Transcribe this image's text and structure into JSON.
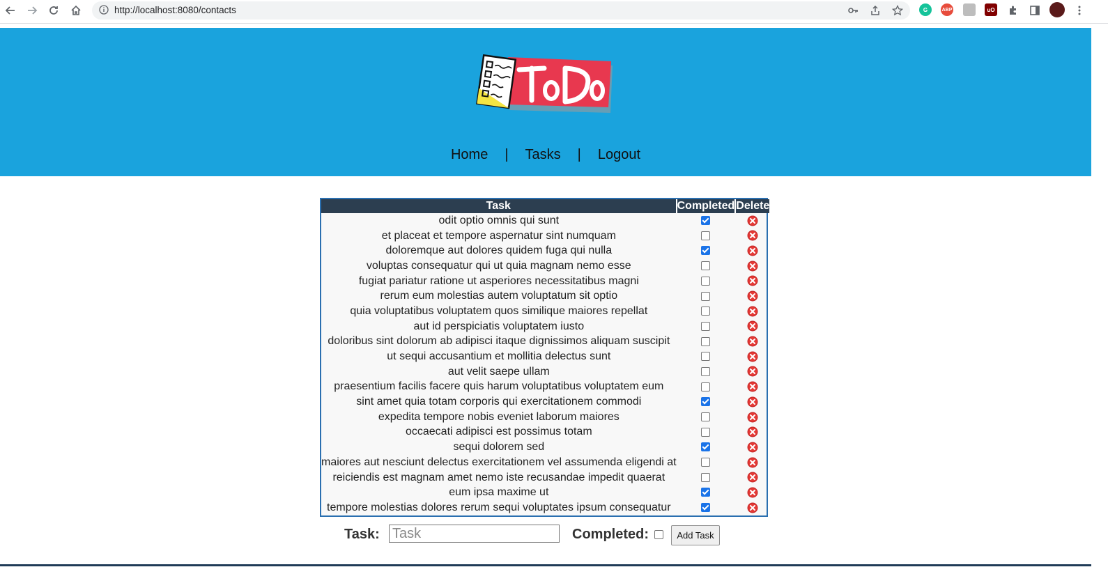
{
  "browser": {
    "url": "http://localhost:8080/contacts",
    "extensions": [
      {
        "name": "grammarly-icon",
        "color": "#15c39a",
        "label": "G"
      },
      {
        "name": "adblock-plus-icon",
        "color": "#e74c3c",
        "label": "ABP"
      },
      {
        "name": "extension-icon",
        "color": "#9e9e9e",
        "label": ""
      },
      {
        "name": "ublock-origin-icon",
        "color": "#800000",
        "label": "uO"
      }
    ]
  },
  "header": {
    "logo_text": "ToDo",
    "nav": [
      {
        "label": "Home"
      },
      {
        "label": "Tasks"
      },
      {
        "label": "Logout"
      }
    ],
    "separator": "|",
    "background_color": "#1aa3dd"
  },
  "table": {
    "columns": [
      "Task",
      "Completed",
      "Delete"
    ],
    "rows": [
      {
        "task": "odit optio omnis qui sunt",
        "completed": true
      },
      {
        "task": "et placeat et tempore aspernatur sint numquam",
        "completed": false
      },
      {
        "task": "doloremque aut dolores quidem fuga qui nulla",
        "completed": true
      },
      {
        "task": "voluptas consequatur qui ut quia magnam nemo esse",
        "completed": false
      },
      {
        "task": "fugiat pariatur ratione ut asperiores necessitatibus magni",
        "completed": false
      },
      {
        "task": "rerum eum molestias autem voluptatum sit optio",
        "completed": false
      },
      {
        "task": "quia voluptatibus voluptatem quos similique maiores repellat",
        "completed": false
      },
      {
        "task": "aut id perspiciatis voluptatem iusto",
        "completed": false
      },
      {
        "task": "doloribus sint dolorum ab adipisci itaque dignissimos aliquam suscipit",
        "completed": false
      },
      {
        "task": "ut sequi accusantium et mollitia delectus sunt",
        "completed": false
      },
      {
        "task": "aut velit saepe ullam",
        "completed": false
      },
      {
        "task": "praesentium facilis facere quis harum voluptatibus voluptatem eum",
        "completed": false
      },
      {
        "task": "sint amet quia totam corporis qui exercitationem commodi",
        "completed": true
      },
      {
        "task": "expedita tempore nobis eveniet laborum maiores",
        "completed": false
      },
      {
        "task": "occaecati adipisci est possimus totam",
        "completed": false
      },
      {
        "task": "sequi dolorem sed",
        "completed": true
      },
      {
        "task": "maiores aut nesciunt delectus exercitationem vel assumenda eligendi at",
        "completed": false
      },
      {
        "task": "reiciendis est magnam amet nemo iste recusandae impedit quaerat",
        "completed": false
      },
      {
        "task": "eum ipsa maxime ut",
        "completed": true
      },
      {
        "task": "tempore molestias dolores rerum sequi voluptates ipsum consequatur",
        "completed": true
      }
    ]
  },
  "form": {
    "task_label": "Task:",
    "task_placeholder": "Task",
    "task_value": "",
    "completed_label": "Completed:",
    "completed_checked": false,
    "add_button_label": "Add Task"
  }
}
